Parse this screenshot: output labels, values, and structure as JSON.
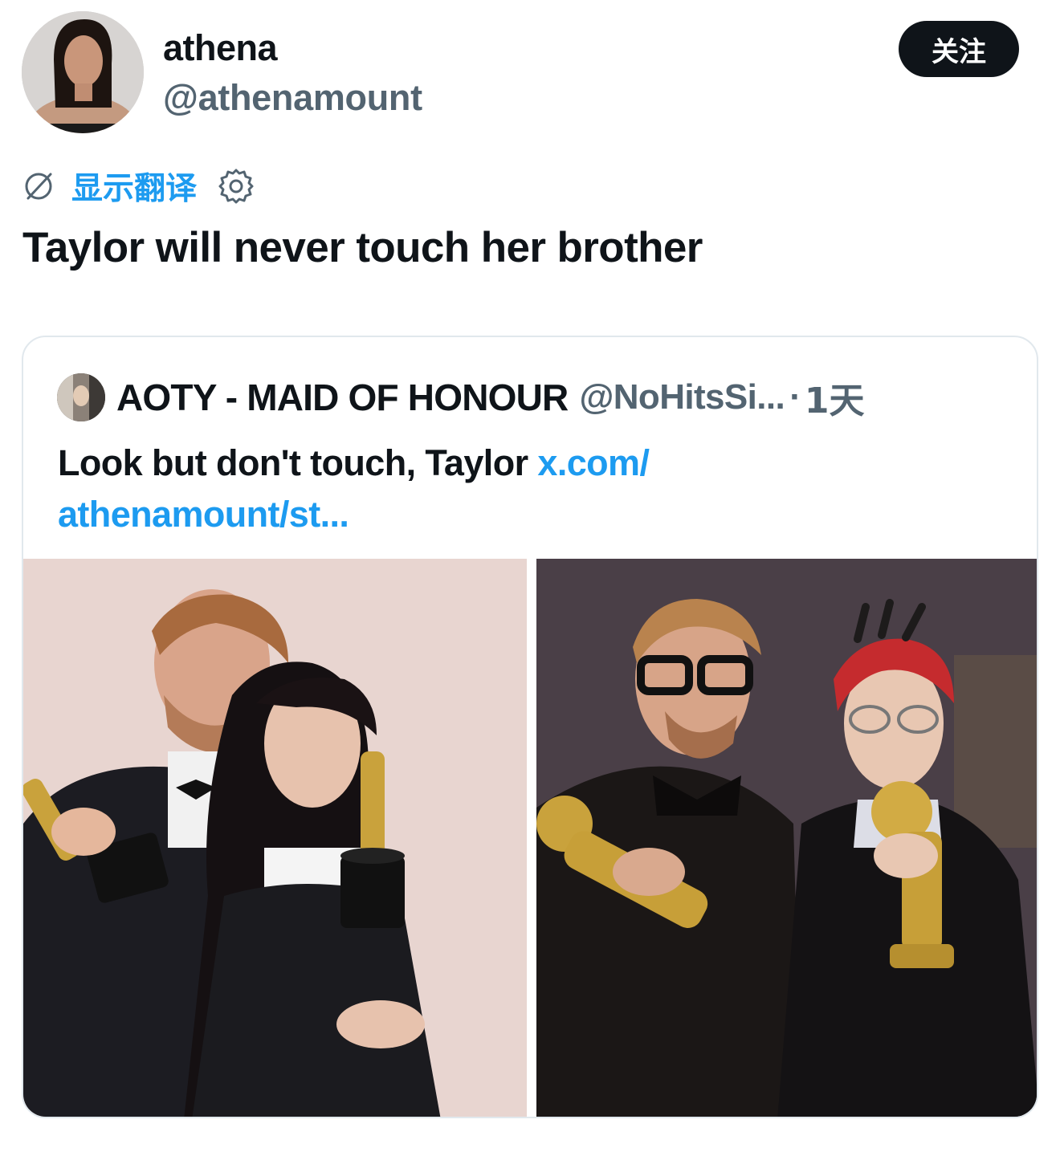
{
  "author": {
    "display_name": "athena",
    "handle": "@athenamount",
    "avatar_icon": "profile-photo"
  },
  "follow_button": {
    "label": "关注"
  },
  "translate": {
    "label": "显示翻译",
    "icons": [
      "globe-slash-icon",
      "gear-icon"
    ]
  },
  "tweet": {
    "text": "Taylor will never touch her brother"
  },
  "quoted_tweet": {
    "display_name": "AOTY - MAID OF HONOUR",
    "handle": "@NoHitsSi...",
    "separator": "·",
    "time": "1天",
    "text": "Look but don't touch, Taylor ",
    "link_line1": "x.com/",
    "link_line2": "athenamount/st...",
    "images": [
      {
        "name": "photo-oscars",
        "text": ""
      },
      {
        "name": "photo-golden-globes",
        "text": ""
      }
    ]
  },
  "colors": {
    "text_primary": "#0f1419",
    "text_secondary": "#536471",
    "link": "#1d9bf0",
    "follow_bg": "#0f1419",
    "border": "#e1e8ed"
  }
}
